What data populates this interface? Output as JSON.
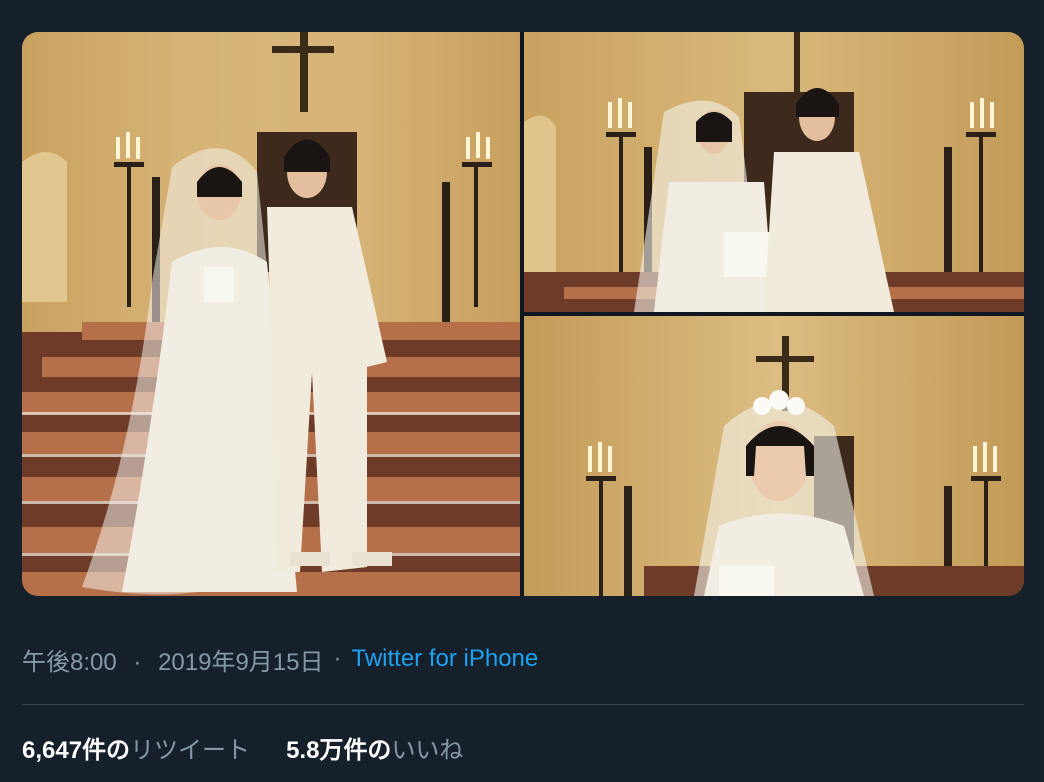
{
  "tweet": {
    "time": "午後8:00",
    "separator": "·",
    "date": "2019年9月15日",
    "source": "Twitter for iPhone"
  },
  "stats": {
    "retweets": {
      "count": "6,647",
      "unit": "件の",
      "label": "リツイート"
    },
    "likes": {
      "count": "5.8万",
      "unit": "件の",
      "label": "いいね"
    }
  },
  "colors": {
    "background": "#15202b",
    "link": "#1da1f2",
    "muted": "#8899a6",
    "divider": "#38444d"
  }
}
